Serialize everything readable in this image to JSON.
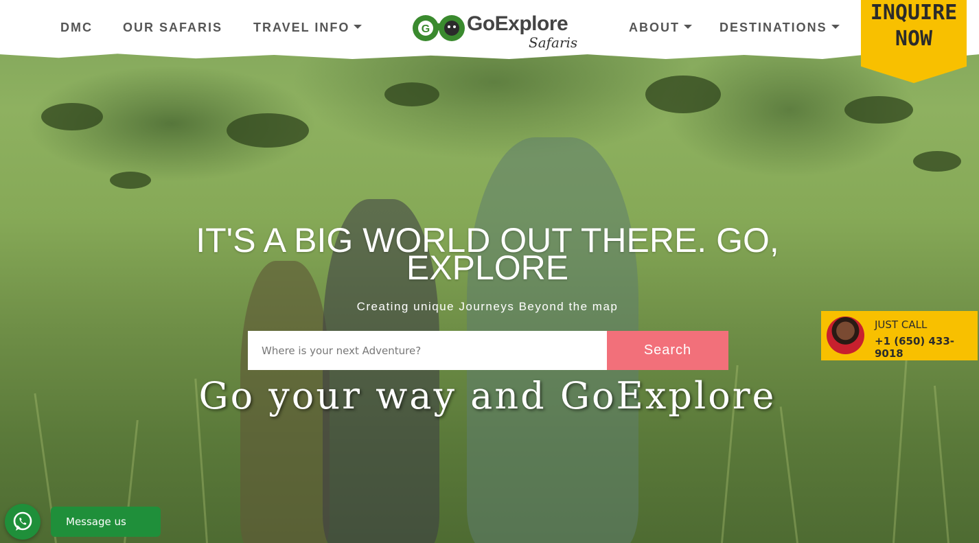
{
  "nav": {
    "left": [
      {
        "label": "DMC",
        "dropdown": false
      },
      {
        "label": "OUR SAFARIS",
        "dropdown": false
      },
      {
        "label": "TRAVEL INFO",
        "dropdown": true
      }
    ],
    "right": [
      {
        "label": "ABOUT",
        "dropdown": true
      },
      {
        "label": "DESTINATIONS",
        "dropdown": true
      }
    ]
  },
  "logo": {
    "main": "GoExplore",
    "sub": "Safaris"
  },
  "inquire": {
    "line1": "INQUIRE",
    "line2": "NOW",
    "color": "#f8c000"
  },
  "hero": {
    "title_line1": "IT'S A BIG WORLD OUT THERE. GO,",
    "title_line2": "EXPLORE",
    "subtitle": "Creating unique Journeys Beyond the map",
    "tagline": "Go your way and GoExplore"
  },
  "search": {
    "placeholder": "Where is your next Adventure?",
    "button_label": "Search",
    "button_color": "#f2707a"
  },
  "call": {
    "label": "JUST CALL",
    "number": "+1 (650) 433-9018"
  },
  "whatsapp": {
    "label": "Message us",
    "color": "#1f8f3a"
  }
}
